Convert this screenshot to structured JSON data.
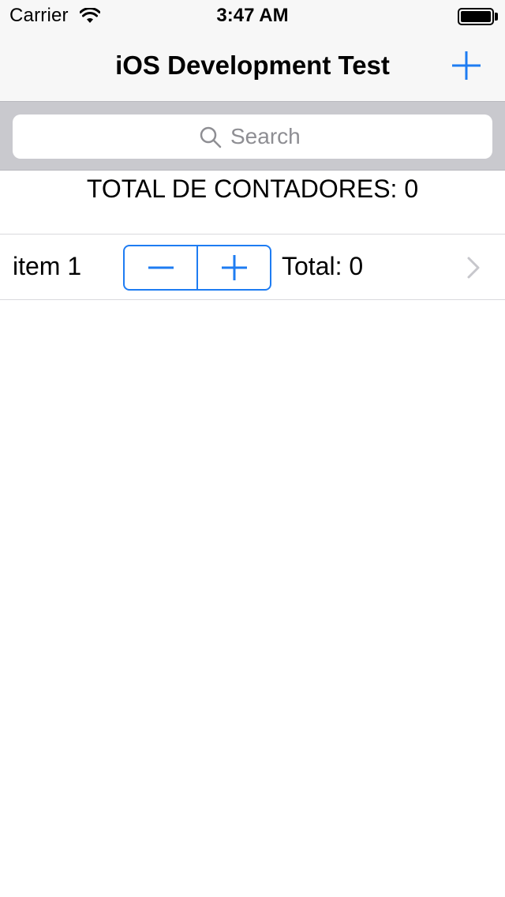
{
  "status_bar": {
    "carrier": "Carrier",
    "time": "3:47 AM"
  },
  "nav": {
    "title": "iOS Development Test",
    "add_icon": "plus-icon"
  },
  "search": {
    "placeholder": "Search",
    "value": ""
  },
  "summary": {
    "total_text": "TOTAL DE CONTADORES: 0"
  },
  "rows": [
    {
      "label": "item 1",
      "total_text": "Total: 0"
    }
  ],
  "colors": {
    "accent": "#1e7cf2",
    "bar_background": "#f7f7f7",
    "search_background": "#c9c9ce",
    "separator": "#d9d9dd",
    "placeholder": "#8e8e93",
    "chevron": "#c7c7cc"
  }
}
